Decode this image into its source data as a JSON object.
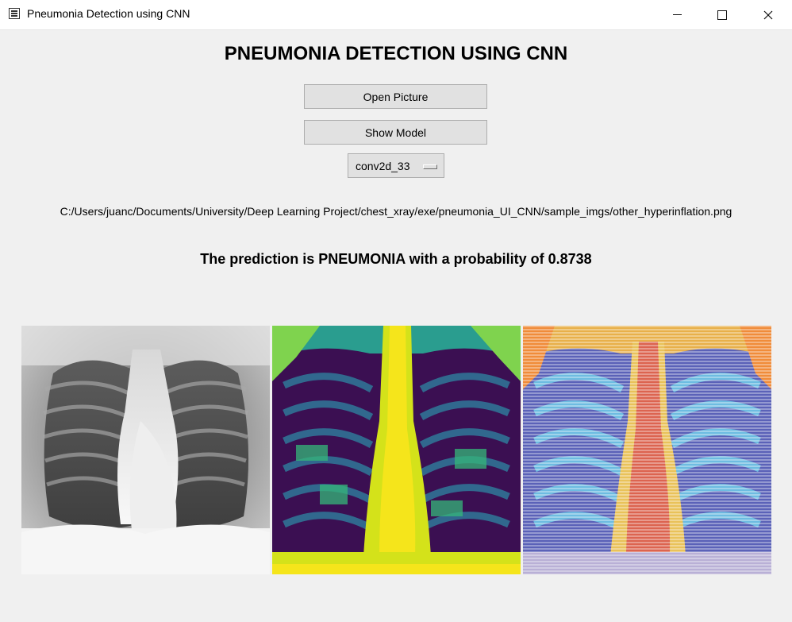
{
  "window": {
    "title": "Pneumonia Detection using CNN",
    "icon": "feather-icon"
  },
  "main": {
    "heading": "PNEUMONIA DETECTION USING CNN",
    "open_button": "Open Picture",
    "show_model_button": "Show Model",
    "layer_select": {
      "selected": "conv2d_33"
    },
    "file_path": "C:/Users/juanc/Documents/University/Deep Learning Project/chest_xray/exe/pneumonia_UI_CNN/sample_imgs/other_hyperinflation.png",
    "prediction": "The prediction is PNEUMONIA with a probability of 0.8738"
  },
  "images": {
    "original": "chest x-ray",
    "activation": "feature map",
    "overlay": "heatmap overlay"
  },
  "colors": {
    "background": "#f0f0f0",
    "button": "#e1e1e1",
    "button_border": "#adadad",
    "viridis_dark": "#3b0f52",
    "viridis_yellow": "#f5e51b"
  }
}
